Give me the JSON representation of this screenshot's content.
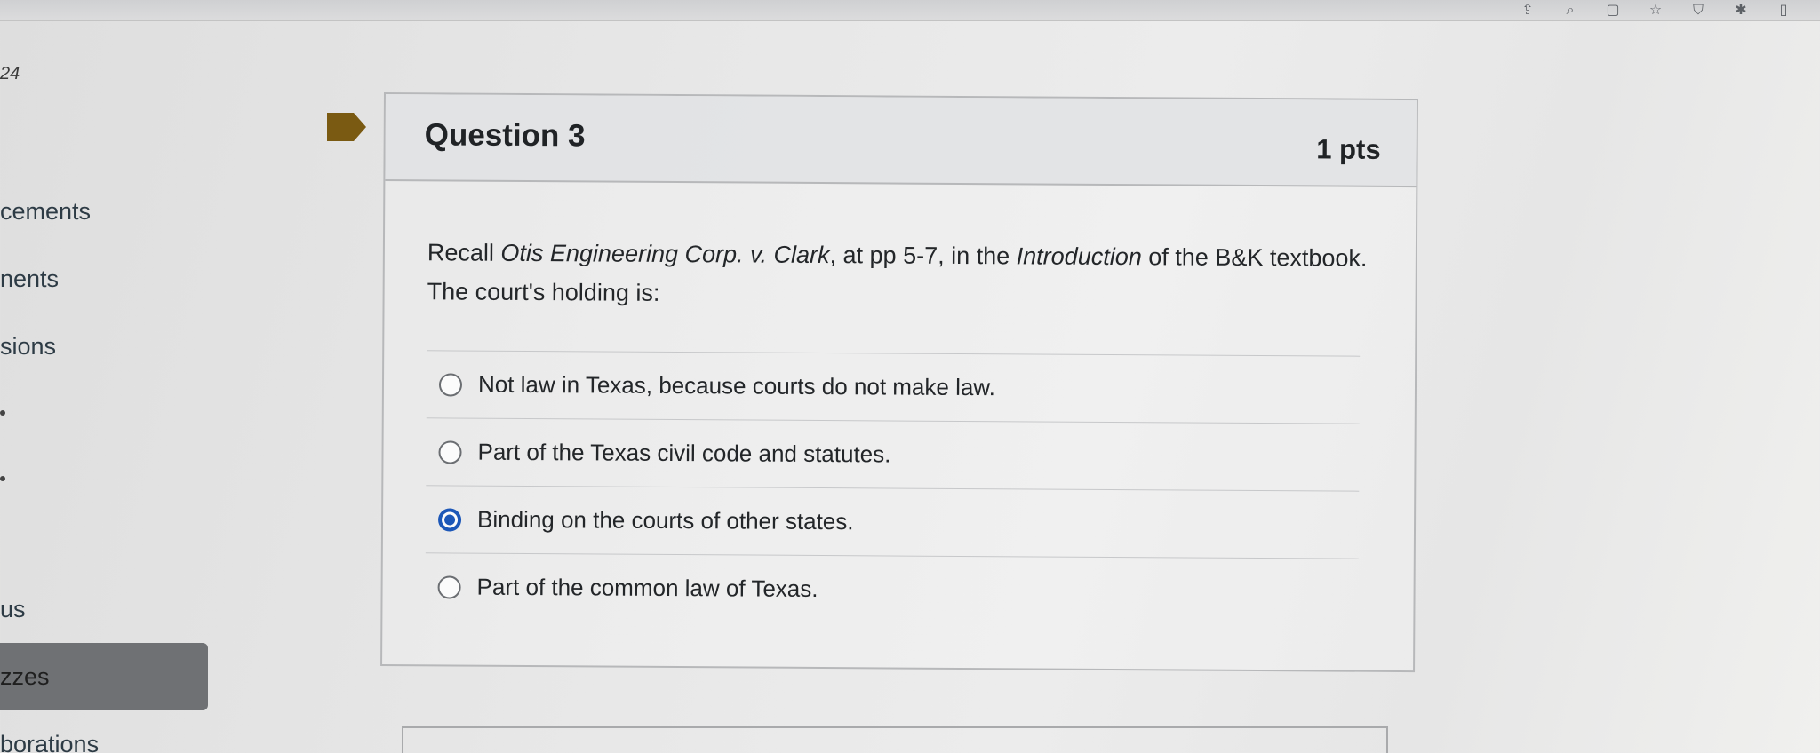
{
  "page": {
    "number_label": "24"
  },
  "sidebar": {
    "items": [
      {
        "label": "cements",
        "active": false
      },
      {
        "label": "nents",
        "active": false
      },
      {
        "label": "sions",
        "active": false
      },
      {
        "label": "us",
        "active": false
      },
      {
        "label": "zzes",
        "active": true
      },
      {
        "label": "borations",
        "active": false
      }
    ]
  },
  "question": {
    "title": "Question 3",
    "points": "1 pts",
    "text_parts": {
      "p1": "Recall ",
      "case": "Otis Engineering Corp. v. Clark",
      "p2": ", at pp 5-7, in the ",
      "section": "Introduction",
      "p3": " of the B&K textbook. The court's holding is:"
    },
    "answers": [
      {
        "label": "Not law in Texas, because courts do not make law.",
        "selected": false
      },
      {
        "label": "Part of the Texas civil code and statutes.",
        "selected": false
      },
      {
        "label": "Binding on the courts of other states.",
        "selected": true
      },
      {
        "label": "Part of the common law of Texas.",
        "selected": false
      }
    ]
  },
  "colors": {
    "flag": "#7a5a12",
    "radio_selected": "#1c57b8",
    "card_border": "#b7b8ba"
  },
  "icons": {
    "flag": "bookmark-flag-icon",
    "browser": [
      "share-icon",
      "zoom-icon",
      "window-icon",
      "star-icon",
      "shield-icon",
      "puzzle-icon",
      "sidebar-icon"
    ]
  }
}
